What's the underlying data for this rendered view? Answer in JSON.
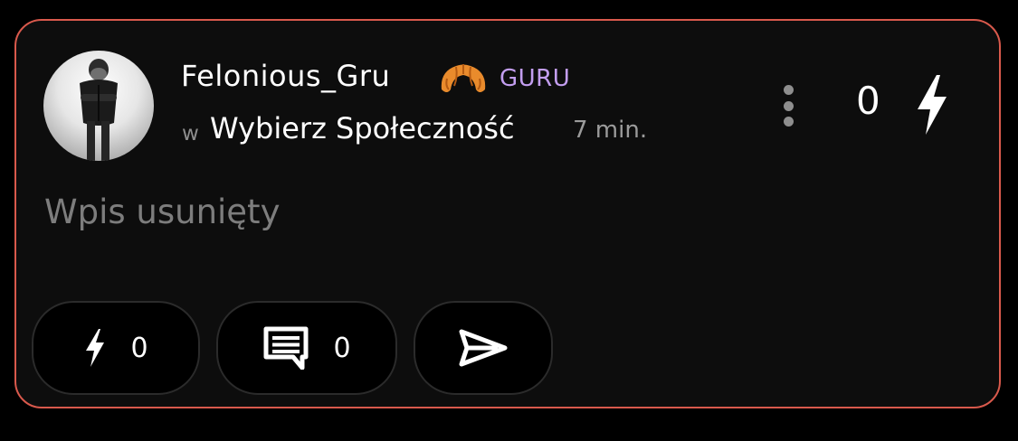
{
  "post": {
    "author": {
      "username": "Felonious_Gru",
      "badge_icon": "croissant-icon",
      "rank": "GURU",
      "rank_color": "#c39ef0"
    },
    "community_prefix": "w",
    "community": "Wybierz Społeczność",
    "time": "7 min.",
    "score": "0",
    "content": "Wpis usunięty",
    "border_color": "#d9594c"
  },
  "actions": {
    "zap": {
      "icon": "lightning-icon",
      "count": "0"
    },
    "comment": {
      "icon": "comment-icon",
      "count": "0"
    },
    "share": {
      "icon": "send-icon"
    }
  }
}
